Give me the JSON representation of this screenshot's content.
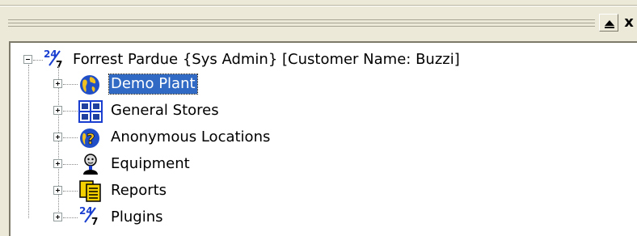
{
  "window": {
    "close_glyph": "x",
    "buttons": [
      "maximize-icon",
      "close-icon"
    ]
  },
  "tree": {
    "root": {
      "label": "Forrest Pardue {Sys Admin} [Customer Name: Buzzi]",
      "icon": "24-7-icon",
      "expanded": true
    },
    "children": [
      {
        "label": "Demo Plant",
        "icon": "globe-icon",
        "selected": true
      },
      {
        "label": "General Stores",
        "icon": "shelves-icon",
        "selected": false
      },
      {
        "label": "Anonymous Locations",
        "icon": "question-globe-icon",
        "selected": false
      },
      {
        "label": "Equipment",
        "icon": "person-icon",
        "selected": false
      },
      {
        "label": "Reports",
        "icon": "documents-icon",
        "selected": false
      },
      {
        "label": "Plugins",
        "icon": "24-7-icon",
        "selected": false
      }
    ],
    "colors": {
      "selection": "#316ac5",
      "panel_bg": "#ffffff",
      "window_bg": "#ece9d8"
    }
  }
}
